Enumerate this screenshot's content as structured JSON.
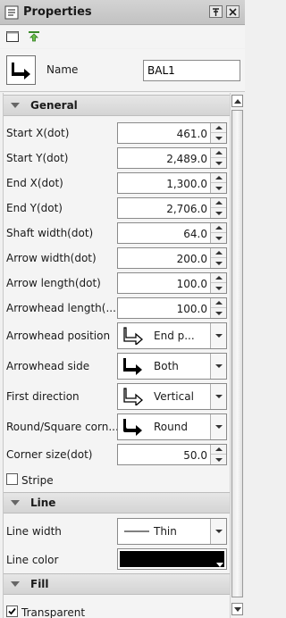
{
  "window": {
    "title": "Properties",
    "pin_icon": "pin-icon",
    "close_icon": "close-icon"
  },
  "toolbar": {
    "items": [
      "new-window-icon",
      "upload-arrow-icon"
    ]
  },
  "name": {
    "label": "Name",
    "value": "BAL1",
    "icon": "bent-arrow-icon"
  },
  "sections": {
    "general": "General",
    "line": "Line",
    "fill": "Fill"
  },
  "general": {
    "start_x": {
      "label": "Start X(dot)",
      "value": "461.0"
    },
    "start_y": {
      "label": "Start Y(dot)",
      "value": "2,489.0"
    },
    "end_x": {
      "label": "End X(dot)",
      "value": "1,300.0"
    },
    "end_y": {
      "label": "End Y(dot)",
      "value": "2,706.0"
    },
    "shaft_width": {
      "label": "Shaft width(dot)",
      "value": "64.0"
    },
    "arrow_width": {
      "label": "Arrow width(dot)",
      "value": "200.0"
    },
    "arrow_length": {
      "label": "Arrow length(dot)",
      "value": "100.0"
    },
    "arrowhead_length": {
      "label": "Arrowhead length(...",
      "value": "100.0"
    },
    "arrowhead_position": {
      "label": "Arrowhead position",
      "value": "End p..."
    },
    "arrowhead_side": {
      "label": "Arrowhead side",
      "value": "Both"
    },
    "first_direction": {
      "label": "First direction",
      "value": "Vertical"
    },
    "round_square": {
      "label": "Round/Square corn...",
      "value": "Round"
    },
    "corner_size": {
      "label": "Corner size(dot)",
      "value": "50.0"
    },
    "stripe": {
      "label": "Stripe",
      "checked": false
    }
  },
  "line": {
    "width": {
      "label": "Line width",
      "value": "Thin"
    },
    "color": {
      "label": "Line color",
      "value": "#000000"
    }
  },
  "fill": {
    "transparent": {
      "label": "Transparent",
      "checked": true
    }
  }
}
